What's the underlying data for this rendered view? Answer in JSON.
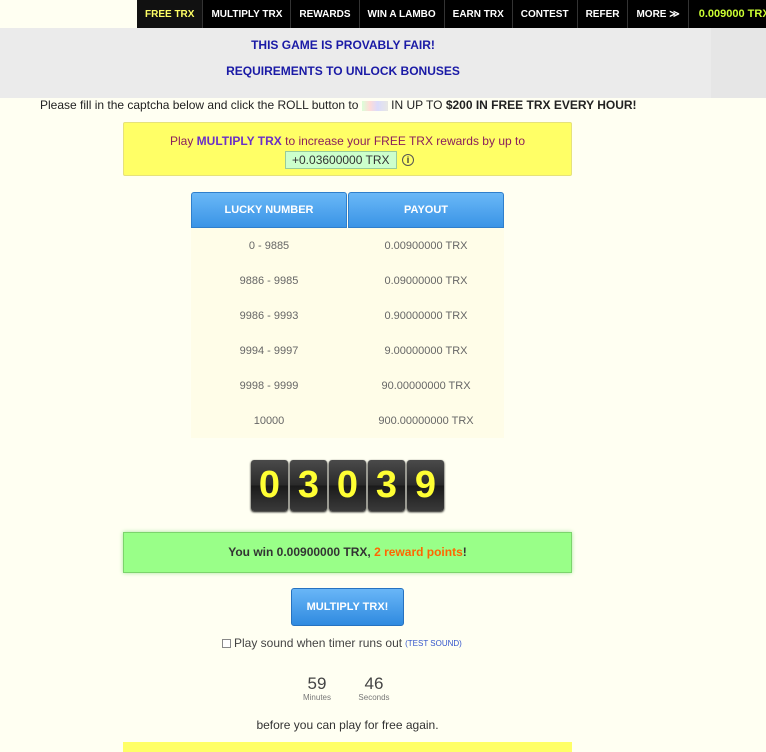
{
  "nav": {
    "items": [
      {
        "label": "FREE TRX",
        "active": true
      },
      {
        "label": "MULTIPLY TRX"
      },
      {
        "label": "REWARDS"
      },
      {
        "label": "WIN A LAMBO"
      },
      {
        "label": "EARN TRX"
      },
      {
        "label": "CONTEST"
      },
      {
        "label": "REFER"
      },
      {
        "label": "MORE ≫"
      }
    ],
    "balance": "0.009000 TRX"
  },
  "links": {
    "provably_fair": "THIS GAME IS PROVABLY FAIR!",
    "requirements": "REQUIREMENTS TO UNLOCK BONUSES"
  },
  "captcha_line": {
    "prefix": "Please fill in the captcha below and click the ROLL button to",
    "suffix": "IN UP TO",
    "bold": "$200 IN FREE TRX EVERY HOUR!"
  },
  "promo": {
    "text_before": "Play",
    "link": "MULTIPLY TRX",
    "text_after": "to increase your FREE TRX rewards by up to",
    "bonus": "+0.03600000 TRX",
    "info": "i"
  },
  "payout_table": {
    "headers": [
      "LUCKY NUMBER",
      "PAYOUT"
    ],
    "rows": [
      [
        "0 - 9885",
        "0.00900000 TRX"
      ],
      [
        "9886 - 9985",
        "0.09000000 TRX"
      ],
      [
        "9986 - 9993",
        "0.90000000 TRX"
      ],
      [
        "9994 - 9997",
        "9.00000000 TRX"
      ],
      [
        "9998 - 9999",
        "90.00000000 TRX"
      ],
      [
        "10000",
        "900.00000000 TRX"
      ]
    ]
  },
  "roll_digits": [
    "0",
    "3",
    "0",
    "3",
    "9"
  ],
  "win": {
    "text": "You win 0.00900000 TRX,",
    "points": "2 reward points",
    "end": "!"
  },
  "multiply_button": "MULTIPLY TRX!",
  "sound": {
    "label": "Play sound when timer runs out",
    "test": "(TEST SOUND)"
  },
  "timer": {
    "minutes": "59",
    "minutes_label": "Minutes",
    "seconds": "46",
    "seconds_label": "Seconds"
  },
  "again_text": "before you can play for free again.",
  "colors": {
    "accent_blue": "#3a94e6",
    "win_green": "#99ff88",
    "promo_yellow": "#ffff66",
    "digit_yellow": "#ffff33",
    "balance_green": "#ccff33"
  }
}
